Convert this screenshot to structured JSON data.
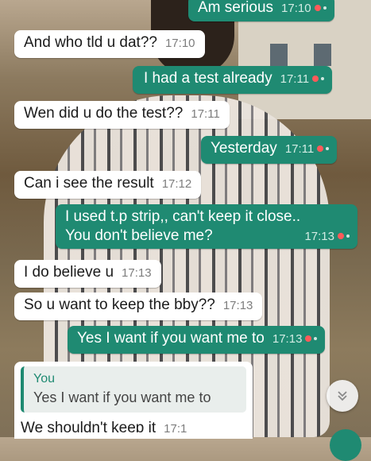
{
  "messages": [
    {
      "text": "Am serious",
      "time": "17:10",
      "dir": "out"
    },
    {
      "text": "And who tld u dat??",
      "time": "17:10",
      "dir": "in"
    },
    {
      "text": "I had a test already",
      "time": "17:11",
      "dir": "out"
    },
    {
      "text": "Wen did u do the test??",
      "time": "17:11",
      "dir": "in"
    },
    {
      "text": "Yesterday",
      "time": "17:11",
      "dir": "out"
    },
    {
      "text": "Can i see the result",
      "time": "17:12",
      "dir": "in"
    },
    {
      "line1": "I used t.p strip,, can't keep it close..",
      "line2": "You don't believe me?",
      "time": "17:13",
      "dir": "out"
    },
    {
      "text": "I do believe u",
      "time": "17:13",
      "dir": "in"
    },
    {
      "text": "So u want to keep the bby??",
      "time": "17:13",
      "dir": "in"
    },
    {
      "text": "Yes I want if you want me to",
      "time": "17:13",
      "dir": "out"
    }
  ],
  "reply": {
    "quote_author": "You",
    "quote_text": "Yes I want if you want me to",
    "text": "We shouldn't keep it",
    "time": "17:1"
  },
  "colors": {
    "outgoing": "#1f8a72",
    "incoming": "#ffffff",
    "tick": "#ff5a5a"
  },
  "icons": {
    "scroll_down": "double-chevron-down-icon"
  }
}
